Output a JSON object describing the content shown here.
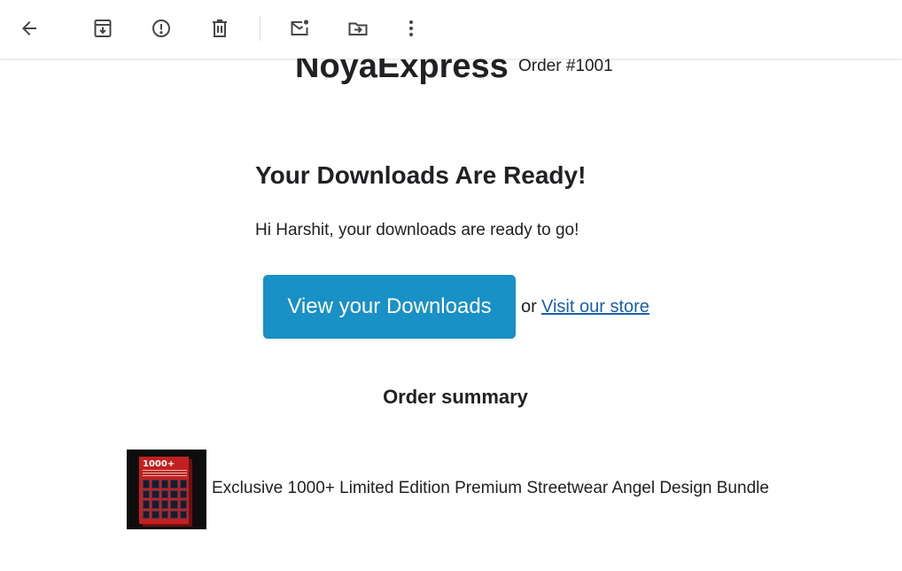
{
  "toolbar": {
    "buttons": [
      {
        "icon": "arrow-left-icon",
        "tooltip": "Back"
      },
      {
        "icon": "archive-icon",
        "tooltip": "Archive"
      },
      {
        "icon": "report-spam-icon",
        "tooltip": "Report spam"
      },
      {
        "icon": "trash-icon",
        "tooltip": "Delete"
      },
      {
        "icon": "mark-unread-icon",
        "tooltip": "Mark as unread"
      },
      {
        "icon": "move-to-icon",
        "tooltip": "Move to"
      },
      {
        "icon": "more-vert-icon",
        "tooltip": "More"
      }
    ]
  },
  "email": {
    "store_name": "NoyaExpress",
    "order_number": "Order #1001",
    "heading": "Your Downloads Are Ready!",
    "greeting": "Hi Harshit, your downloads are ready to go!",
    "cta_label": "View your Downloads",
    "or_text": "or",
    "store_link": "Visit our store",
    "summary_title": "Order summary",
    "product": {
      "name": "Exclusive 1000+ Limited Edition Premium Streetwear Angel Design Bundle",
      "thumbnail_text": "1000+"
    }
  },
  "colors": {
    "accent_button": "#1990c6",
    "link": "#1a5fa8",
    "text": "#202124",
    "icon": "#444746"
  }
}
